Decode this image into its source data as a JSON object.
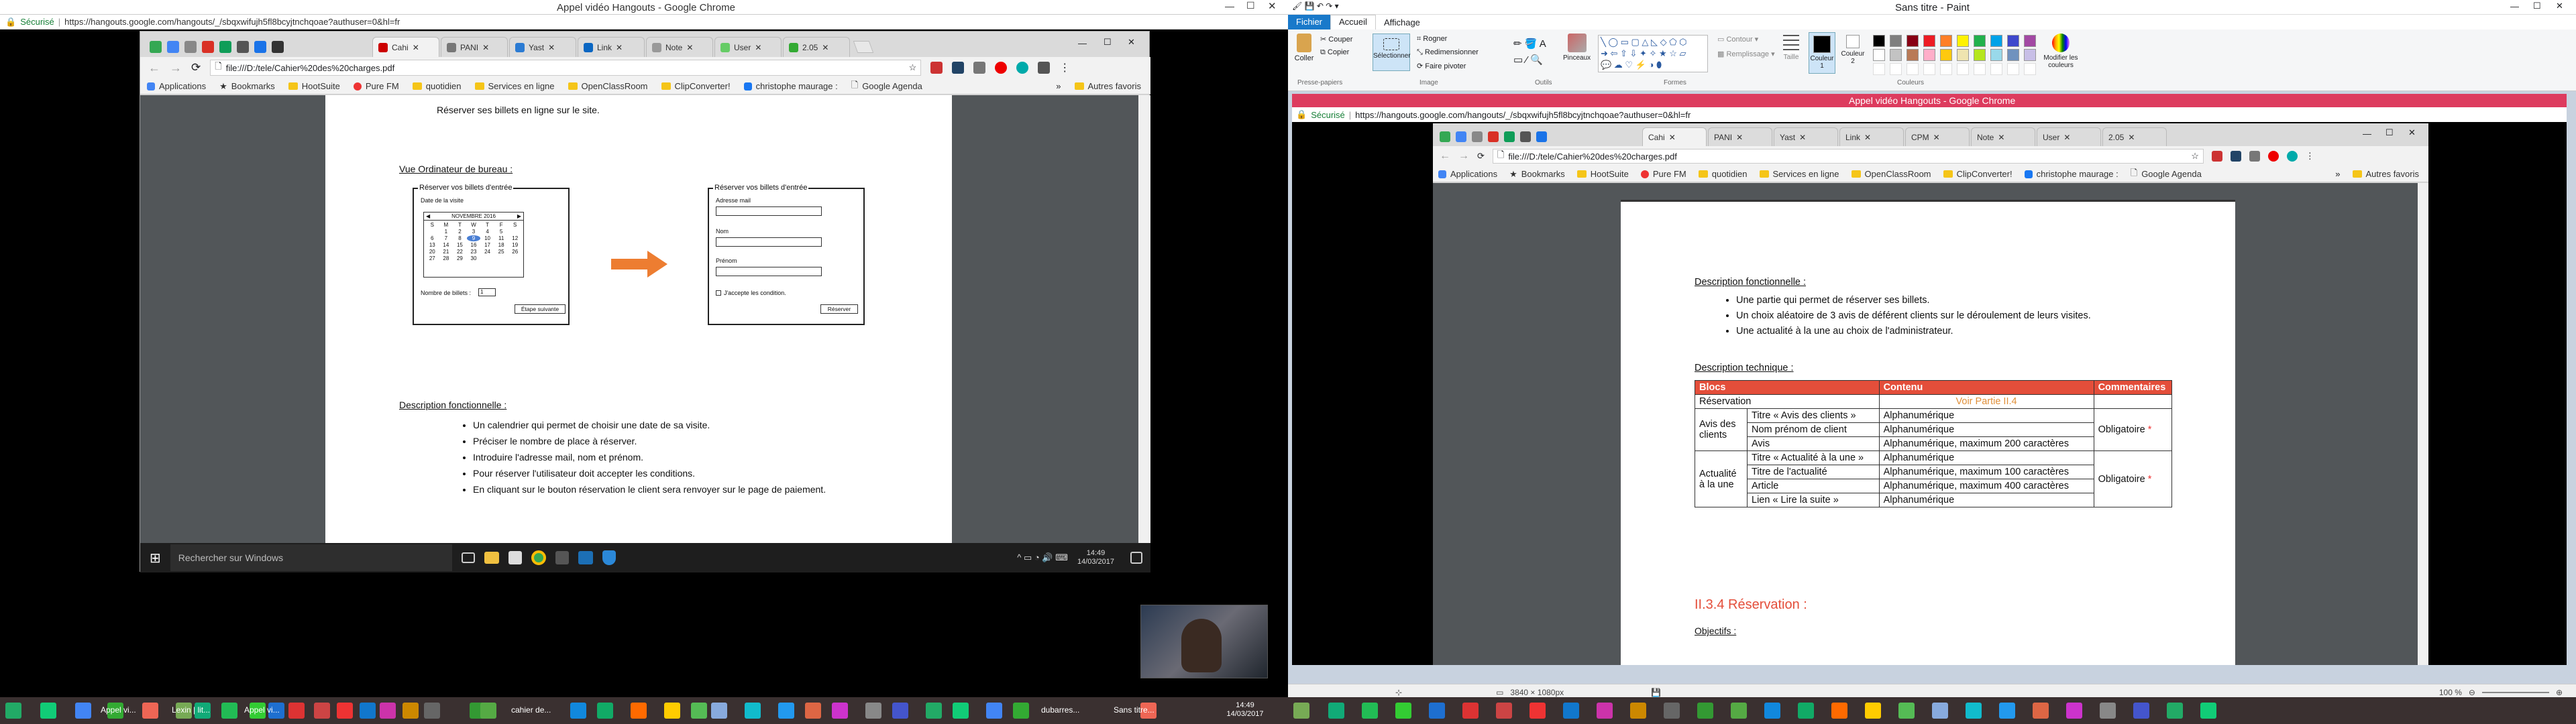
{
  "left": {
    "window_title": "Appel vidéo Hangouts - Google Chrome",
    "secure_label": "Sécurisé",
    "address": "https://hangouts.google.com/hangouts/_/sbqxwifujh5fl8bcyjtnchqoae?authuser=0&hl=fr",
    "tabs": [
      "Cahi",
      "PANI",
      "Yast",
      "Link",
      "Note",
      "User",
      "2.05"
    ],
    "omnibox": "file:///D:/tele/Cahier%20des%20charges.pdf",
    "bookmarks": [
      "Applications",
      "Bookmarks",
      "HootSuite",
      "Pure FM",
      "quotidien",
      "Services en ligne",
      "OpenClassRoom",
      "ClipConverter!",
      "christophe maurage :",
      "Google Agenda"
    ],
    "bookmarks_more": "Autres favoris",
    "doc": {
      "top_line": "Réserver ses billets en ligne sur le site.",
      "heading_desktop": "Vue Ordinateur de bureau :",
      "mock1": {
        "title": "Réserver vos billets d'entrée",
        "date_label": "Date de la visite",
        "month": "NOVEMBRE 2016",
        "days": [
          "S",
          "M",
          "T",
          "W",
          "T",
          "F",
          "S"
        ],
        "rows": [
          [
            "",
            "1",
            "2",
            "3",
            "4",
            "5",
            ""
          ],
          [
            "6",
            "7",
            "8",
            "9",
            "10",
            "11",
            "12"
          ],
          [
            "13",
            "14",
            "15",
            "16",
            "17",
            "18",
            "19"
          ],
          [
            "20",
            "21",
            "22",
            "23",
            "24",
            "25",
            "26"
          ],
          [
            "27",
            "28",
            "29",
            "30",
            "",
            "",
            ""
          ]
        ],
        "tickets_label": "Nombre de billets :",
        "tickets_value": "1",
        "next_button": "Étape suivante"
      },
      "mock2": {
        "title": "Réserver vos billets d'entrée",
        "email_label": "Adresse mail",
        "name_label": "Nom",
        "firstname_label": "Prénom",
        "accept_label": "J'accepte les condition.",
        "reserve_button": "Réserver"
      },
      "heading_func": "Description fonctionnelle :",
      "bullets": [
        "Un calendrier qui permet de choisir une date de sa visite.",
        "Préciser le nombre de place à réserver.",
        "Introduire l'adresse mail, nom et prénom.",
        "Pour réserver l'utilisateur doit accepter les conditions.",
        "En cliquant sur le bouton réservation le client sera renvoyer sur le page de paiement."
      ]
    },
    "taskbar": {
      "search_placeholder": "Rechercher sur Windows",
      "time": "14:49",
      "date": "14/03/2017"
    }
  },
  "right": {
    "paint_title": "Sans titre - Paint",
    "paint_tabs": [
      "Fichier",
      "Accueil",
      "Affichage"
    ],
    "paint_groups": [
      "Presse-papiers",
      "Image",
      "Outils",
      "Formes",
      "Couleurs"
    ],
    "paint_buttons": {
      "paste": "Coller",
      "cut": "Couper",
      "copy": "Copier",
      "select": "Sélectionner",
      "crop": "Rogner",
      "resize": "Redimensionner",
      "rotate": "Faire pivoter",
      "brushes": "Pinceaux",
      "outline": "Contour",
      "fill": "Remplissage",
      "size": "Taille",
      "color1": "Couleur 1",
      "color2": "Couleur 2",
      "edit_colors": "Modifier les couleurs"
    },
    "palette": [
      "#000000",
      "#7f7f7f",
      "#880015",
      "#ed1c24",
      "#ff7f27",
      "#fff200",
      "#22b14c",
      "#00a2e8",
      "#3f48cc",
      "#a349a4",
      "#ffffff",
      "#c3c3c3",
      "#b97a57",
      "#ffaec9",
      "#ffc90e",
      "#efe4b0",
      "#b5e61d",
      "#99d9ea",
      "#7092be",
      "#c8bfe7"
    ],
    "status_size": "3840 × 1080px",
    "zoom": "100 %",
    "inner_title": "Appel vidéo Hangouts - Google Chrome",
    "inner_secure": "Sécurisé",
    "inner_address": "https://hangouts.google.com/hangouts/_/sbqxwifujh5fl8bcyjtnchqoae?authuser=0&hl=fr",
    "inner_tabs": [
      "Cahi",
      "PANI",
      "Yast",
      "Link",
      "CPM",
      "Note",
      "User",
      "2.05"
    ],
    "inner_omnibox": "file:///D:/tele/Cahier%20des%20charges.pdf",
    "inner_bookmarks": [
      "Applications",
      "Bookmarks",
      "HootSuite",
      "Pure FM",
      "quotidien",
      "Services en ligne",
      "OpenClassRoom",
      "ClipConverter!",
      "christophe maurage :",
      "Google Agenda"
    ],
    "inner_bookmarks_more": "Autres favoris",
    "doc": {
      "heading_func": "Description fonctionnelle :",
      "bullets": [
        "Une partie qui permet de réserver ses billets.",
        "Un choix aléatoire de 3 avis de déférent clients sur le déroulement de leurs visites.",
        "Une actualité à la une au choix de l'administrateur."
      ],
      "heading_tech": "Description technique :",
      "table": {
        "headers": [
          "Blocs",
          "Contenu",
          "Commentaires"
        ],
        "reservation": {
          "bloc": "Réservation",
          "link": "Voir Partie II.4"
        },
        "avis": {
          "bloc": "Avis des clients",
          "rows": [
            [
              "Titre « Avis des clients »",
              "Alphanumérique"
            ],
            [
              "Nom prénom de client",
              "Alphanumérique"
            ],
            [
              "Avis",
              "Alphanumérique, maximum 200 caractères"
            ]
          ],
          "comment": "Obligatoire",
          "star": "*"
        },
        "actu": {
          "bloc": "Actualité à la une",
          "rows": [
            [
              "Titre « Actualité à la une »",
              "Alphanumérique"
            ],
            [
              "Titre de l'actualité",
              "Alphanumérique, maximum 100 caractères"
            ],
            [
              "Article",
              "Alphanumérique, maximum 400 caractères"
            ],
            [
              "Lien « Lire la suite »",
              "Alphanumérique"
            ]
          ],
          "comment": "Obligatoire",
          "star": "*"
        }
      },
      "section_heading": "II.3.4 Réservation :",
      "objectifs": "Objectifs :"
    }
  },
  "taskbar_bottom": {
    "apps": [
      "Appel vi...",
      "Lexin | lit...",
      "Appel vi...",
      "cahier de...",
      "dubarres...",
      "Sans titre..."
    ],
    "time": "14:49",
    "date": "14/03/2017"
  }
}
